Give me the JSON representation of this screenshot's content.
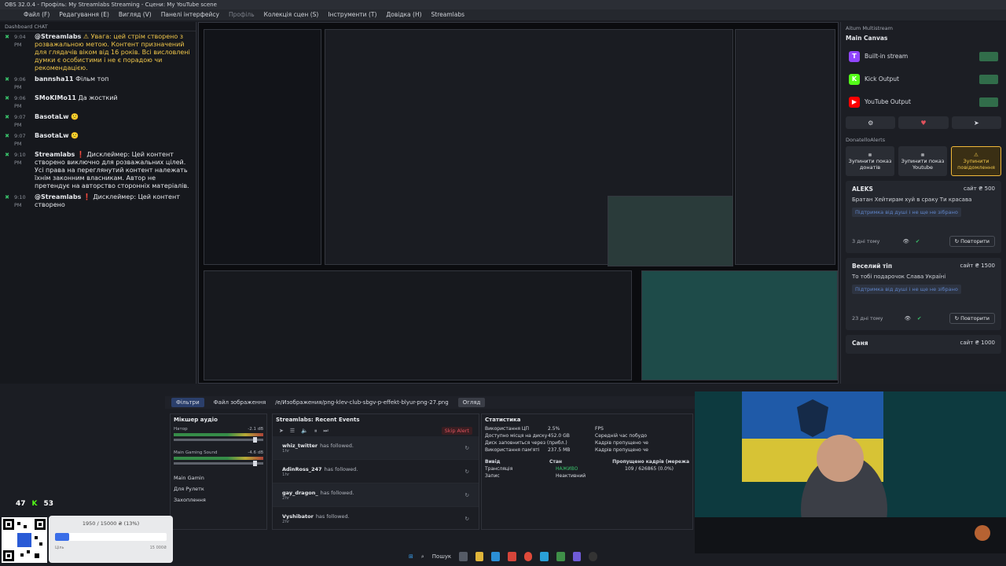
{
  "window": {
    "title": "OBS 32.0.4 - Профіль: My Streamlabs Streaming - Сцени: My YouTube scene"
  },
  "menu": [
    "Файл (F)",
    "Редагування (E)",
    "Вигляд (V)",
    "Панелі інтерфейсу",
    "Профіль",
    "Колекція сцен (S)",
    "Інструменти (T)",
    "Довідка (H)",
    "Streamlabs"
  ],
  "chat": {
    "title": "Dashboard CHAT",
    "messages": [
      {
        "time": "9:04 PM",
        "user": "@Streamlabs",
        "text": "⚠ Увага: цей стрім створено з розважальною метою. Контент призначений для глядачів віком від 16 років. Всі висловлені думки є особистими і не є порадою чи рекомендацією.",
        "warn": true
      },
      {
        "time": "9:06 PM",
        "user": "bannsha11",
        "text": "Фільм топ"
      },
      {
        "time": "9:06 PM",
        "user": "SMoKIMo11",
        "text": "Да жосткий"
      },
      {
        "time": "9:07 PM",
        "user": "BasotaLw",
        "text": "🙁"
      },
      {
        "time": "9:07 PM",
        "user": "BasotaLw",
        "text": "🙁"
      },
      {
        "time": "9:10 PM",
        "user": "Streamlabs",
        "text": "❗ Дисклеймер: Цей контент створено виключно для розважальних цілей. Усі права на переглянутий контент належать їхнім законним власникам. Автор не претендує на авторство сторонніх матеріалів."
      },
      {
        "time": "9:10 PM",
        "user": "@Streamlabs",
        "text": "❗ Дисклеймер: Цей контент створено"
      }
    ]
  },
  "multistream": {
    "title": "Aitum Multistream",
    "canvas": "Main Canvas",
    "outputs": [
      {
        "name": "Built-in stream",
        "color": "#9146ff",
        "letter": "T"
      },
      {
        "name": "Kick Output",
        "color": "#53fc18",
        "letter": "K"
      },
      {
        "name": "YouTube Output",
        "color": "#ff0000",
        "letter": "▶"
      }
    ]
  },
  "donations": {
    "title": "DonatelloAlerts",
    "buttons": [
      "Зупинити показ донатів",
      "Зупинити показ Youtube",
      "Зупинити повідомлення"
    ],
    "cards": [
      {
        "name": "ALEKS",
        "amount": "сайт ₴ 500",
        "msg": "Братан Хейтирам хуй в сраку Ти красава",
        "note": "Підтримка від душі і не ще не зібрано",
        "when": "3 дні тому",
        "repeat": "Повторити"
      },
      {
        "name": "Веселий тіп",
        "amount": "сайт ₴ 1500",
        "msg": "То тобі подарочок Слава Україні",
        "note": "Підтримка від душі і не ще не зібрано",
        "when": "23 дні тому",
        "repeat": "Повторити"
      },
      {
        "name": "Саня",
        "amount": "сайт ₴ 1000",
        "msg": "",
        "note": "",
        "when": "",
        "repeat": ""
      }
    ]
  },
  "lower": {
    "filters": "Фільтри",
    "image_file": "Файл зображення",
    "path": "/e/Изображения/png-klev-club-sbgv-p-effekt-blyur-png-27.png",
    "overview": "Огляд"
  },
  "mixer": {
    "title": "Мікшер аудіо",
    "rows": [
      {
        "name": "Натор",
        "db": "-2.1 dB"
      },
      {
        "name": "Main Gaming Sound",
        "db": "-4.6 dB"
      }
    ],
    "items": [
      "Main Gamin",
      "Для Рулетк",
      "Захоплення"
    ]
  },
  "events": {
    "title": "Streamlabs: Recent Events",
    "skip": "Skip Alert",
    "rows": [
      {
        "user": "whiz_twitter",
        "action": "has followed.",
        "ago": "1hr"
      },
      {
        "user": "AdinRoss_247",
        "action": "has followed.",
        "ago": "1hr"
      },
      {
        "user": "gay_dragon_",
        "action": "has followed.",
        "ago": "2hr"
      },
      {
        "user": "Vyshibator",
        "action": "has followed.",
        "ago": "2hr"
      }
    ]
  },
  "stats": {
    "title": "Статистика",
    "cpu_label": "Використання ЦП",
    "cpu": "2.5%",
    "disk_label": "Доступно місця на диску",
    "disk": "452.0 GB",
    "full_label": "Диск заповниться через (прибл.)",
    "full": "",
    "mem_label": "Використання пам'яті",
    "mem": "237.5 MB",
    "fps_label": "FPS",
    "avg_label": "Середній час побудо",
    "skip1_label": "Кадрів пропущено че",
    "skip2_label": "Кадрів пропущено че",
    "output_head": "Вивід",
    "state_head": "Стан",
    "dropped_head": "Пропущено кадрів (мережа",
    "rows": [
      {
        "name": "Трансляція",
        "state": "НАЖИВО",
        "dropped": "109 / 626865 (0.0%)"
      },
      {
        "name": "Запис",
        "state": "Неактивний",
        "dropped": ""
      }
    ]
  },
  "goal": {
    "text": "1950 / 15000 ₴ (13%)",
    "progress": 0.13,
    "current": "1950",
    "min": "Ціль",
    "max": "15 000₴"
  },
  "counts": {
    "viewers": "47",
    "kick": "53"
  },
  "taskbar": {
    "search": "Пошук"
  },
  "colors": {
    "accent": "#f0b83a",
    "live": "#39c26b",
    "alert": "#e0525c",
    "twitch": "#9146ff",
    "kick": "#53fc18",
    "youtube": "#ff0000"
  }
}
